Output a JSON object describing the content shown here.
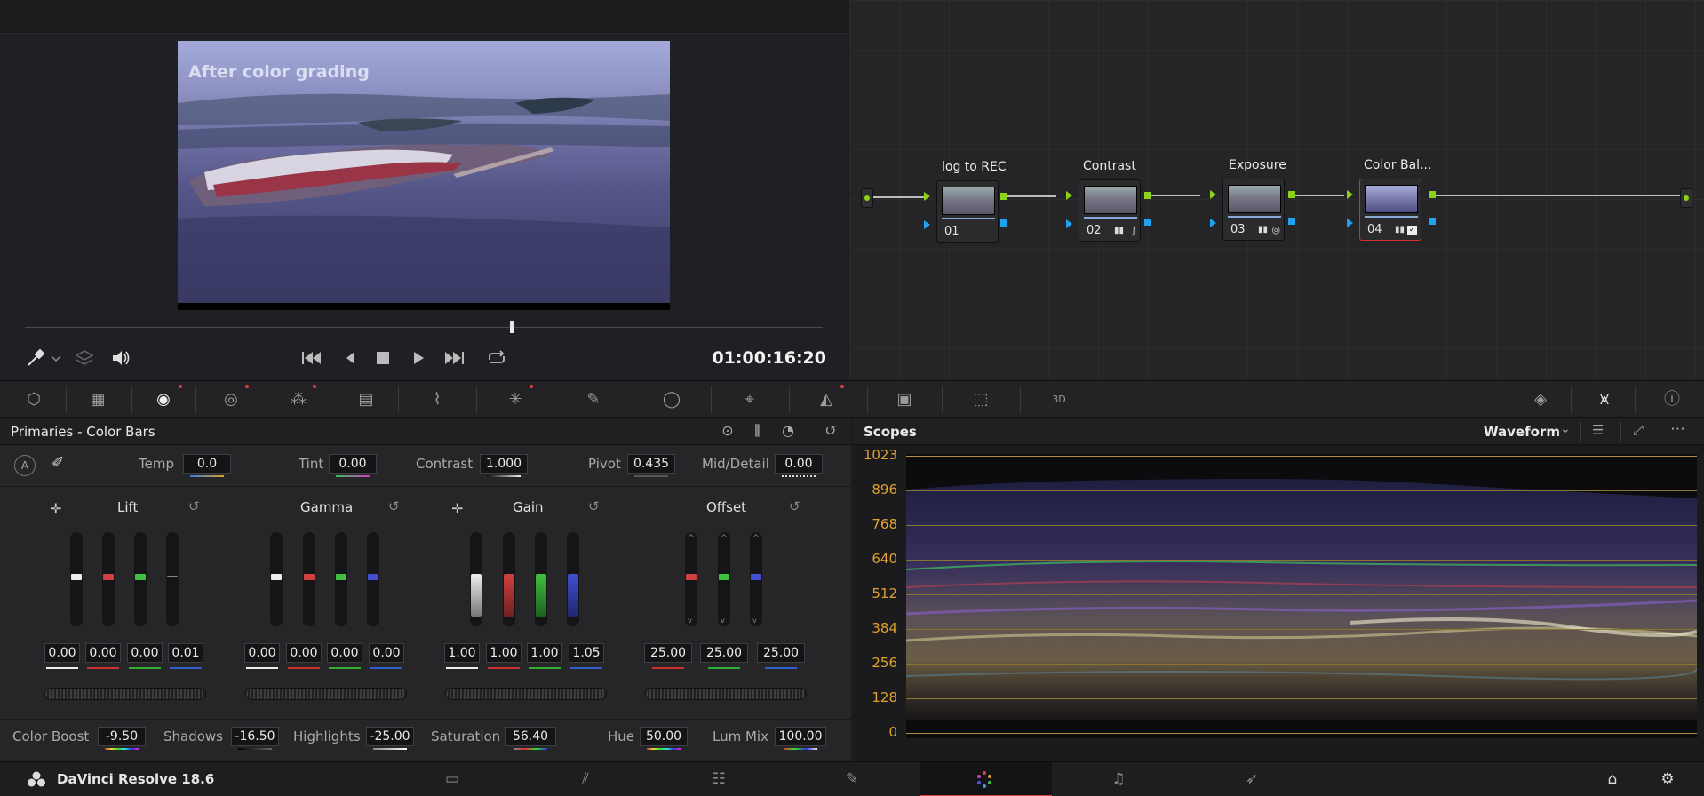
{
  "viewer": {
    "overlay_text": "After color grading",
    "timecode": "01:00:16:20",
    "playback_position": 0.61
  },
  "node_graph": {
    "nodes": [
      {
        "label": "log to REC",
        "number": "01",
        "selected": false
      },
      {
        "label": "Contrast",
        "number": "02",
        "selected": false
      },
      {
        "label": "Exposure",
        "number": "03",
        "selected": false
      },
      {
        "label": "Color Bal...",
        "number": "04",
        "selected": true
      }
    ]
  },
  "primaries": {
    "title": "Primaries - Color Bars",
    "auto_label": "A",
    "adjust_row": [
      {
        "label": "Temp",
        "value": "0.0"
      },
      {
        "label": "Tint",
        "value": "0.00"
      },
      {
        "label": "Contrast",
        "value": "1.000"
      },
      {
        "label": "Pivot",
        "value": "0.435"
      },
      {
        "label": "Mid/Detail",
        "value": "0.00"
      }
    ],
    "wheels": [
      {
        "title": "Lift",
        "values": [
          "0.00",
          "0.00",
          "0.00",
          "0.01"
        ]
      },
      {
        "title": "Gamma",
        "values": [
          "0.00",
          "0.00",
          "0.00",
          "0.00"
        ]
      },
      {
        "title": "Gain",
        "values": [
          "1.00",
          "1.00",
          "1.00",
          "1.05"
        ]
      },
      {
        "title": "Offset",
        "values": [
          "25.00",
          "25.00",
          "25.00"
        ]
      }
    ],
    "bottom_row": [
      {
        "label": "Color Boost",
        "value": "-9.50"
      },
      {
        "label": "Shadows",
        "value": "-16.50"
      },
      {
        "label": "Highlights",
        "value": "-25.00"
      },
      {
        "label": "Saturation",
        "value": "56.40"
      },
      {
        "label": "Hue",
        "value": "50.00"
      },
      {
        "label": "Lum Mix",
        "value": "100.00"
      }
    ]
  },
  "scopes": {
    "title": "Scopes",
    "mode": "Waveform",
    "scale": [
      "1023",
      "896",
      "768",
      "640",
      "512",
      "384",
      "256",
      "128",
      "0"
    ]
  },
  "app": {
    "name": "DaVinci Resolve 18.6"
  },
  "colors": {
    "accent_red": "#e04040",
    "node_green": "#8cd11a",
    "node_blue": "#1ea3f0",
    "scope_label": "#e0a030"
  }
}
